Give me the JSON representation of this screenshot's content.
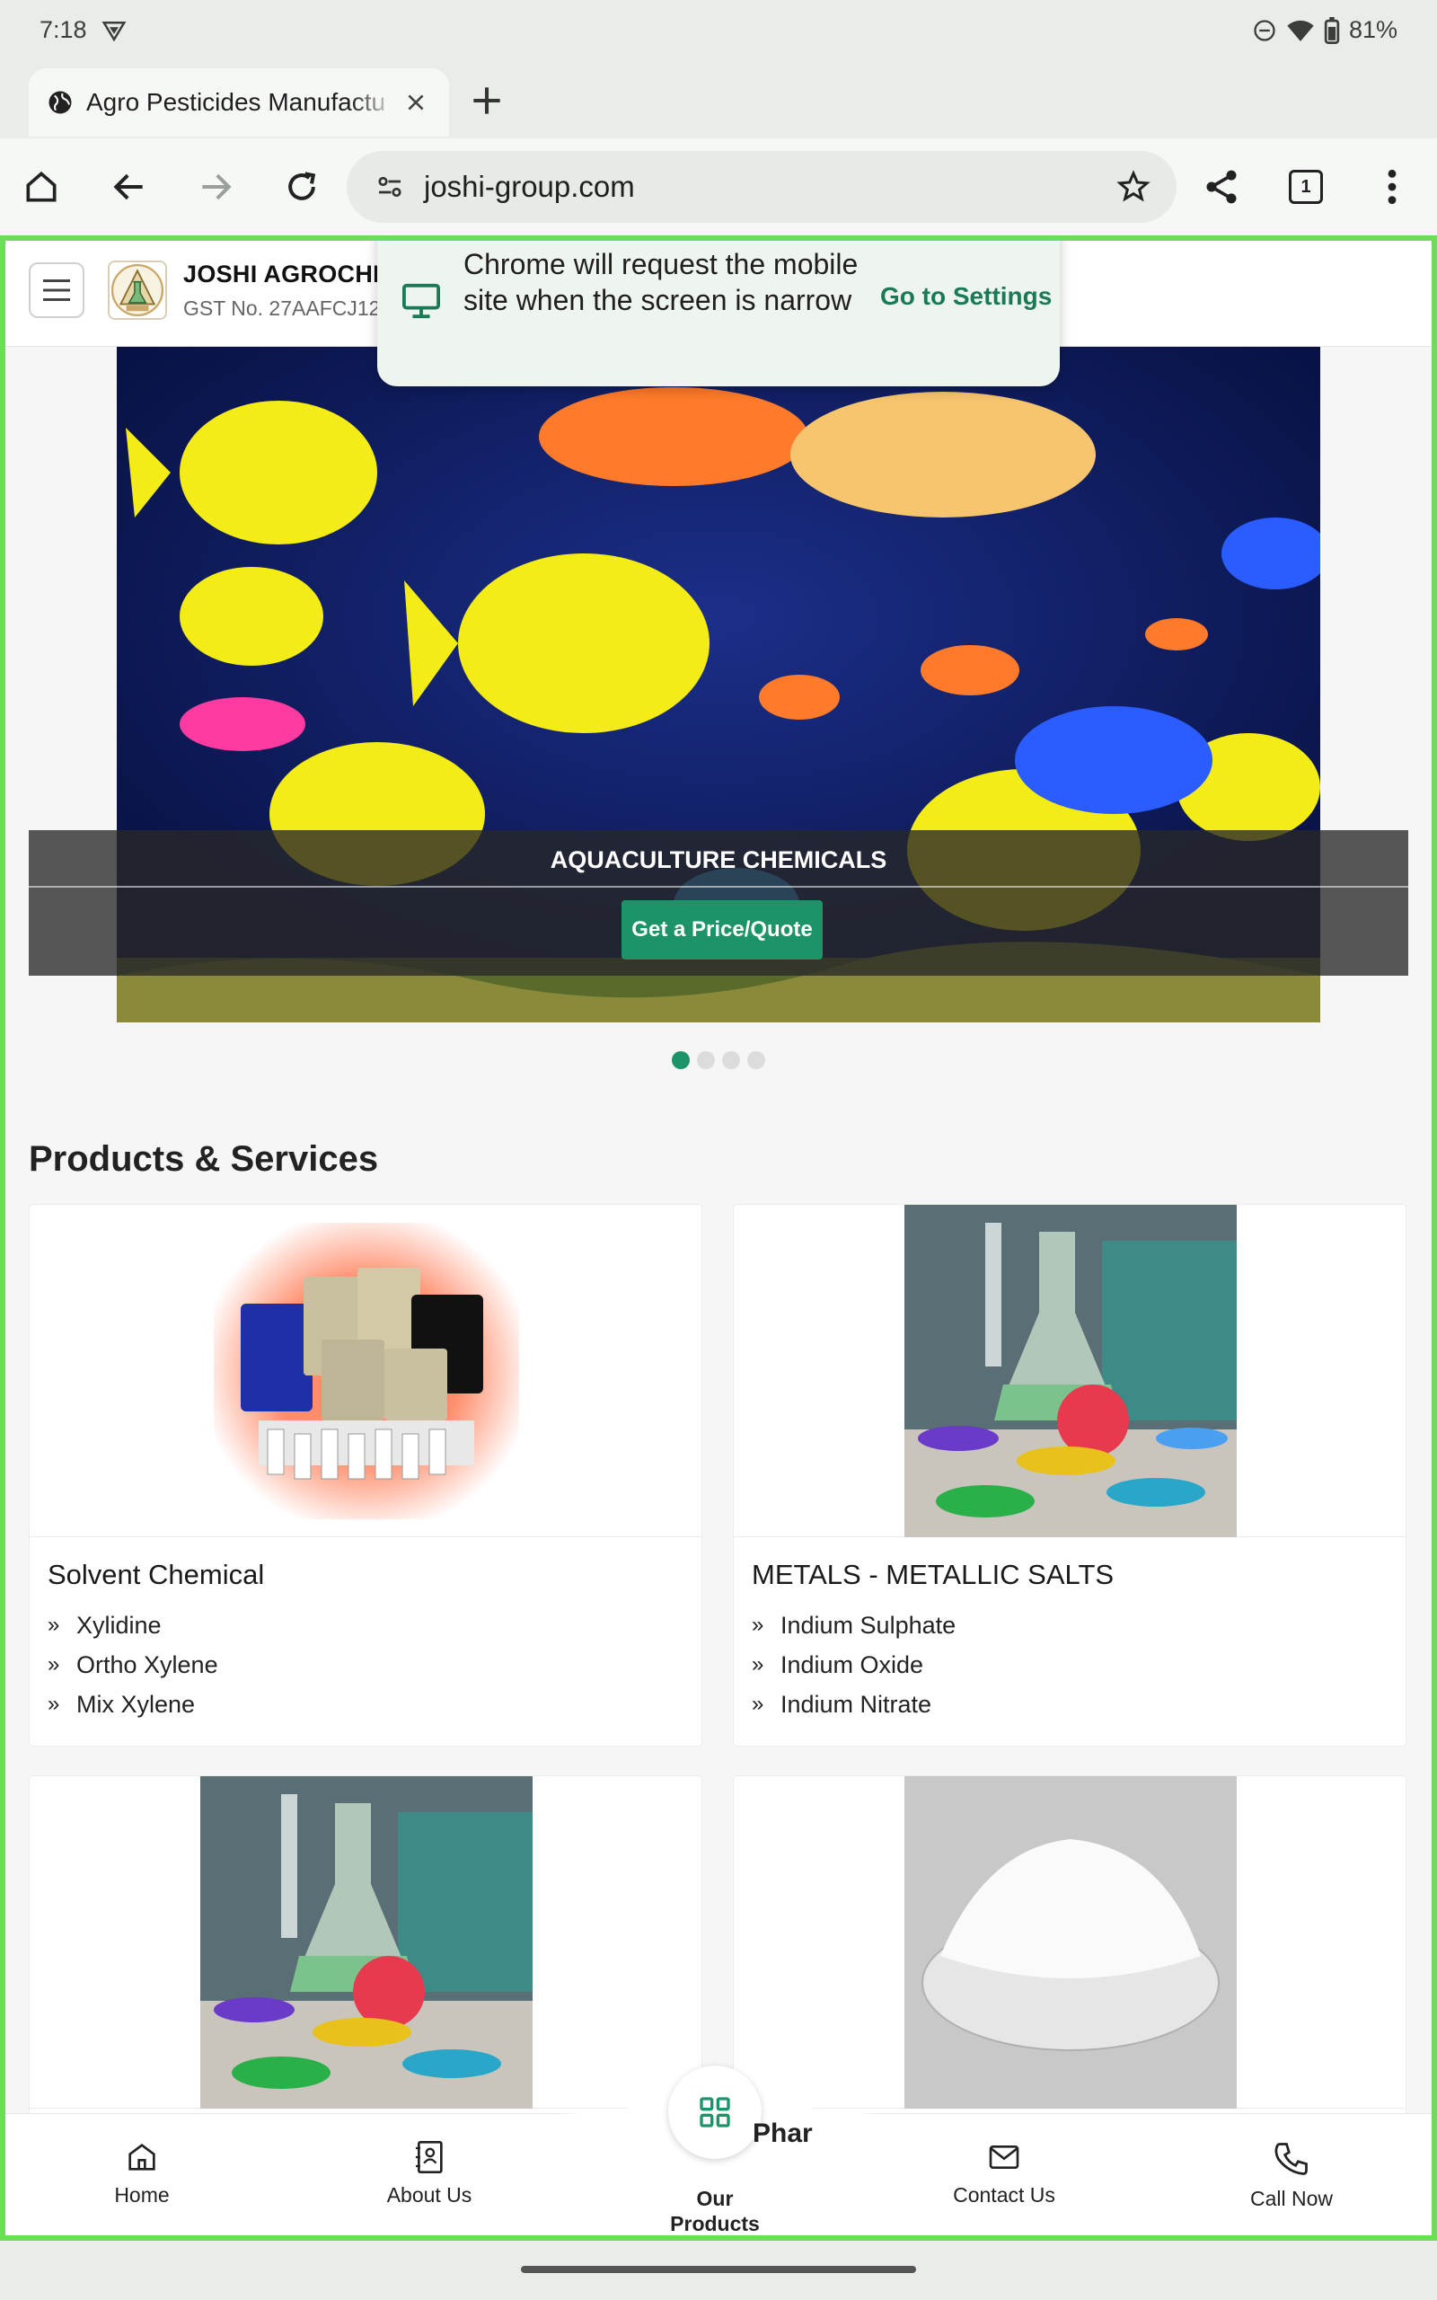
{
  "status_bar": {
    "time": "7:18",
    "battery": "81%"
  },
  "tab": {
    "title": "Agro Pesticides Manufactu"
  },
  "toolbar": {
    "url": "joshi-group.com",
    "tab_count": "1"
  },
  "popup": {
    "message": "Chrome will request the mobile site when the screen is narrow",
    "action": "Go to Settings"
  },
  "site": {
    "company_name": "JOSHI AGROCHE",
    "gst": "GST No. 27AAFCJ12",
    "logo_text": "JOSHI"
  },
  "banner": {
    "caption": "AQUACULTURE CHEMICALS",
    "button": "Get a Price/Quote",
    "slide_count": 4,
    "active_slide": 1
  },
  "products_section": {
    "title": "Products & Services",
    "cards": [
      {
        "name": "Solvent Chemical",
        "items": [
          "Xylidine",
          "Ortho Xylene",
          "Mix Xylene"
        ]
      },
      {
        "name": "METALS - METALLIC SALTS",
        "items": [
          "Indium Sulphate",
          "Indium Oxide",
          "Indium Nitrate"
        ]
      }
    ],
    "partial_card_label": "Phar"
  },
  "bottom_nav": {
    "home": "Home",
    "about": "About Us",
    "products_line1": "Our",
    "products_line2": "Products",
    "contact": "Contact Us",
    "call": "Call Now"
  },
  "colors": {
    "accent": "#1c9468",
    "focus_border": "#6edc5a"
  }
}
